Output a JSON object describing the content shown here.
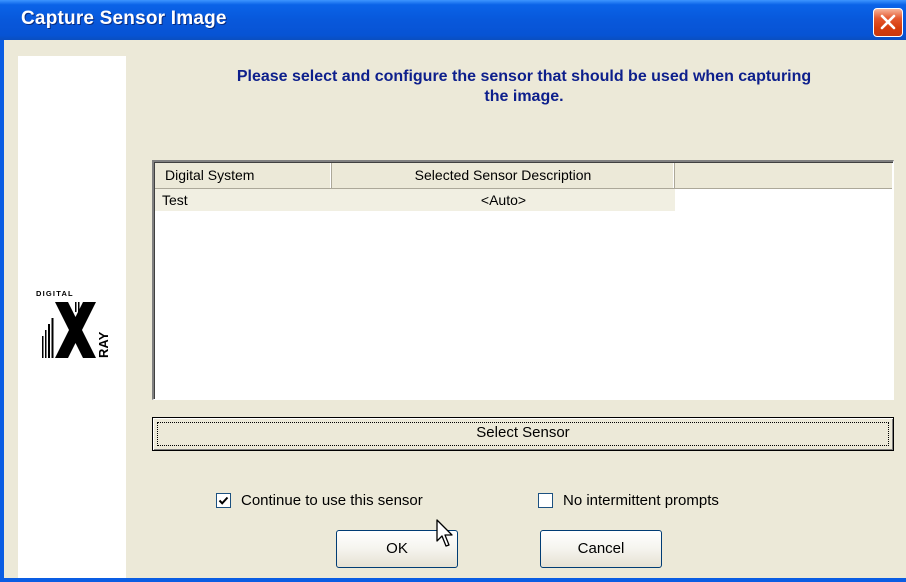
{
  "window": {
    "title": "Capture Sensor Image"
  },
  "logo": {
    "top_text": "DIGITAL",
    "letter": "X",
    "side_text": "RAY"
  },
  "instruction": {
    "line1": "Please select and configure the sensor that should be used when capturing",
    "line2": "the image."
  },
  "sensor_list": {
    "columns": [
      "Digital System",
      "Selected Sensor Description",
      ""
    ],
    "rows": [
      {
        "digital_system": "Test",
        "description": "<Auto>"
      }
    ]
  },
  "buttons": {
    "select_sensor": "Select Sensor",
    "ok": "OK",
    "cancel": "Cancel"
  },
  "options": {
    "continue_label": "Continue to use this sensor",
    "continue_checked": true,
    "no_prompts_label": "No intermittent prompts",
    "no_prompts_checked": false
  },
  "colors": {
    "title_bar": "#0858db",
    "instruction_text": "#0d1f8c",
    "dialog_face": "#ece9d8",
    "close_button": "#d63d0d"
  }
}
